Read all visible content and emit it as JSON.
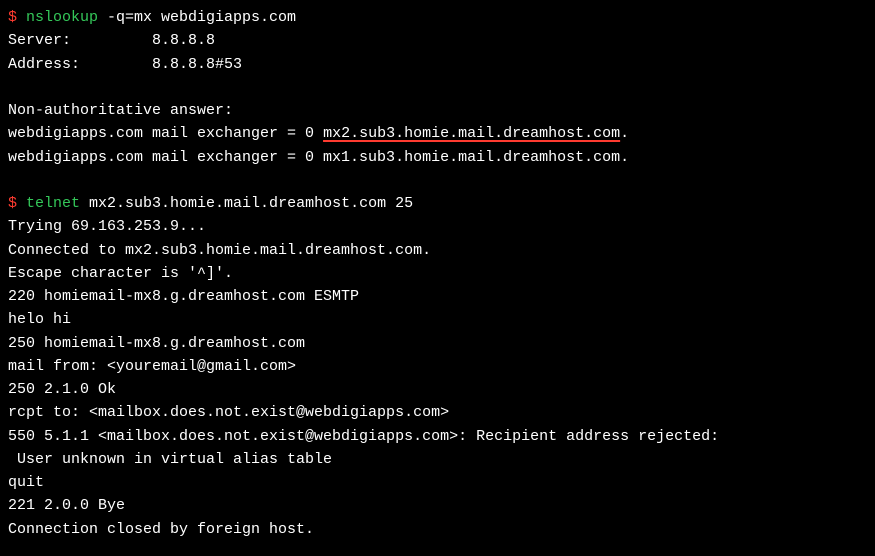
{
  "cmd1": {
    "prompt": "$ ",
    "command": "nslookup",
    "args": " -q=mx webdigiapps.com"
  },
  "nslookup": {
    "server_label": "Server:         ",
    "server_value": "8.8.8.8",
    "address_label": "Address:        ",
    "address_value": "8.8.8.8#53",
    "nonauth": "Non-authoritative answer:",
    "mx1_prefix": "webdigiapps.com mail exchanger = 0 ",
    "mx1_host": "mx2.sub3.homie.mail.dreamhost.com",
    "mx1_suffix": ".",
    "mx2": "webdigiapps.com mail exchanger = 0 mx1.sub3.homie.mail.dreamhost.com."
  },
  "cmd2": {
    "prompt": "$ ",
    "command": "telnet",
    "args": " mx2.sub3.homie.mail.dreamhost.com 25"
  },
  "telnet": {
    "trying": "Trying 69.163.253.9...",
    "connected": "Connected to mx2.sub3.homie.mail.dreamhost.com.",
    "escape": "Escape character is '^]'.",
    "banner": "220 homiemail-mx8.g.dreamhost.com ESMTP",
    "helo": "helo hi",
    "helo_resp": "250 homiemail-mx8.g.dreamhost.com",
    "mailfrom": "mail from: <youremail@gmail.com>",
    "mailfrom_resp": "250 2.1.0 Ok",
    "rcptto": "rcpt to: <mailbox.does.not.exist@webdigiapps.com>",
    "rcptto_resp1": "550 5.1.1 <mailbox.does.not.exist@webdigiapps.com>: Recipient address rejected:",
    "rcptto_resp2": " User unknown in virtual alias table",
    "quit": "quit",
    "quit_resp": "221 2.0.0 Bye",
    "closed": "Connection closed by foreign host."
  }
}
